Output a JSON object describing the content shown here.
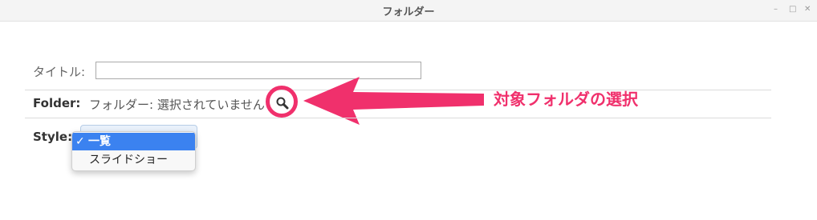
{
  "window": {
    "title": "フォルダー"
  },
  "form": {
    "title_label": "タイトル:",
    "title_value": "",
    "folder_label": "Folder:",
    "folder_status": "フォルダー: 選択されていません",
    "style_label": "Style:",
    "style_options": [
      "一覧",
      "スライドショー"
    ],
    "style_selected": "一覧"
  },
  "annotation": {
    "text": "対象フォルダの選択",
    "color": "#f0306c"
  },
  "icons": {
    "search": "magnifier-icon",
    "check": "checkmark-icon"
  }
}
